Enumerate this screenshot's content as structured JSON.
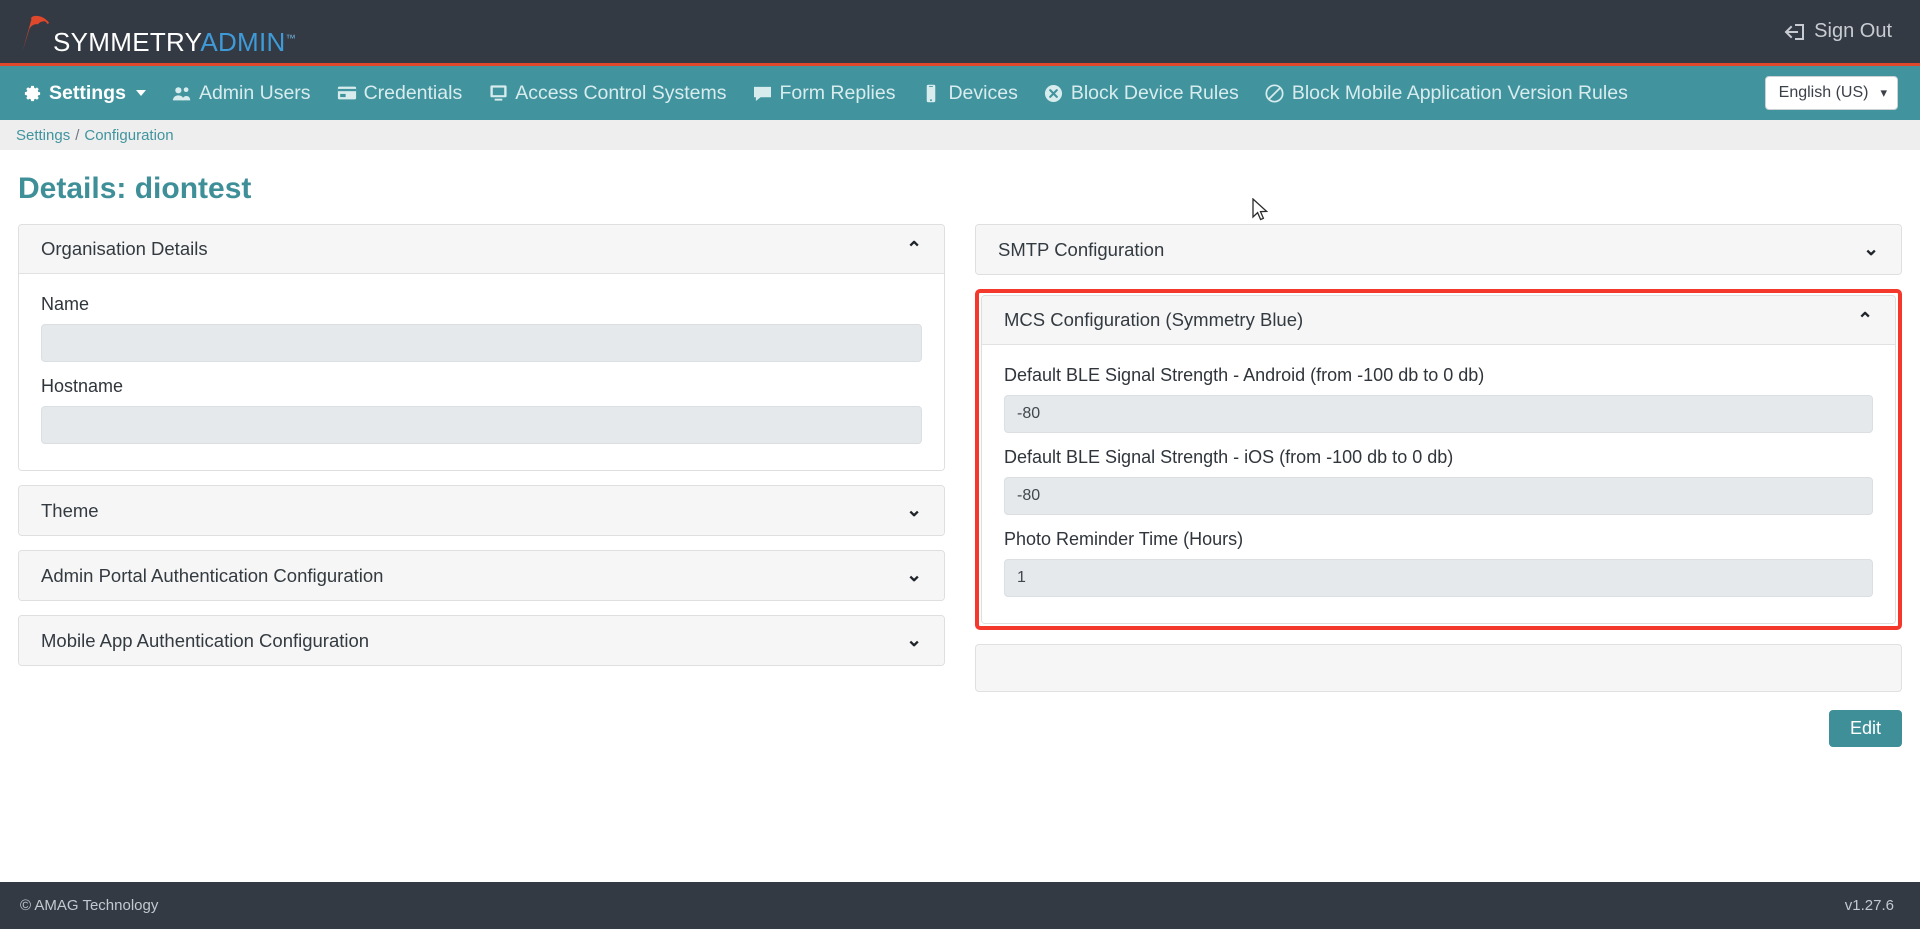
{
  "header": {
    "brand": {
      "word1": "SYMMETRY",
      "word2": "ADMIN",
      "trademark": "™"
    },
    "signout_label": "Sign Out",
    "signout_icon": "sign-out-icon"
  },
  "nav": {
    "items": [
      {
        "label": "Settings",
        "icon": "gear-icon",
        "active": true,
        "has_caret": true
      },
      {
        "label": "Admin Users",
        "icon": "users-icon",
        "active": false,
        "has_caret": false
      },
      {
        "label": "Credentials",
        "icon": "card-icon",
        "active": false,
        "has_caret": false
      },
      {
        "label": "Access Control Systems",
        "icon": "monitor-icon",
        "active": false,
        "has_caret": false
      },
      {
        "label": "Form Replies",
        "icon": "comment-icon",
        "active": false,
        "has_caret": false
      },
      {
        "label": "Devices",
        "icon": "mobile-icon",
        "active": false,
        "has_caret": false
      },
      {
        "label": "Block Device Rules",
        "icon": "times-circle-icon",
        "active": false,
        "has_caret": false
      },
      {
        "label": "Block Mobile Application Version Rules",
        "icon": "ban-icon",
        "active": false,
        "has_caret": false
      }
    ],
    "language": {
      "selected": "English (US)",
      "chevron": "❯"
    }
  },
  "breadcrumb": {
    "root": "Settings",
    "separator": "/",
    "current": "Configuration"
  },
  "page": {
    "title": "Details: diontest"
  },
  "left_column": {
    "panels": [
      {
        "title": "Organisation Details",
        "expanded": true,
        "chevron": "⌃",
        "fields": [
          {
            "label": "Name",
            "value": "",
            "placeholder": ""
          },
          {
            "label": "Hostname",
            "value": "",
            "placeholder": ""
          }
        ]
      },
      {
        "title": "Theme",
        "expanded": false,
        "chevron": "⌄",
        "fields": []
      },
      {
        "title": "Admin Portal Authentication Configuration",
        "expanded": false,
        "chevron": "⌄",
        "fields": []
      },
      {
        "title": "Mobile App Authentication Configuration",
        "expanded": false,
        "chevron": "⌄",
        "fields": []
      }
    ]
  },
  "right_column": {
    "smtp_panel": {
      "title": "SMTP Configuration",
      "expanded": false,
      "chevron": "⌄"
    },
    "mcs_panel": {
      "title": "MCS Configuration (Symmetry Blue)",
      "expanded": true,
      "chevron": "⌃",
      "highlighted": true,
      "highlight_color": "#f4392c",
      "fields": [
        {
          "label": "Default BLE Signal Strength - Android (from -100 db to 0 db)",
          "value": "-80"
        },
        {
          "label": "Default BLE Signal Strength - iOS (from -100 db to 0 db)",
          "value": "-80"
        },
        {
          "label": "Photo Reminder Time (Hours)",
          "value": "1"
        }
      ]
    },
    "edit_button": "Edit"
  },
  "footer": {
    "copyright": "© AMAG Technology",
    "version": "v1.27.6"
  },
  "theme": {
    "dark": "#343a44",
    "teal": "#41949e",
    "accent_red": "#e0482c",
    "link": "#41949e",
    "title": "#3f8f99"
  }
}
